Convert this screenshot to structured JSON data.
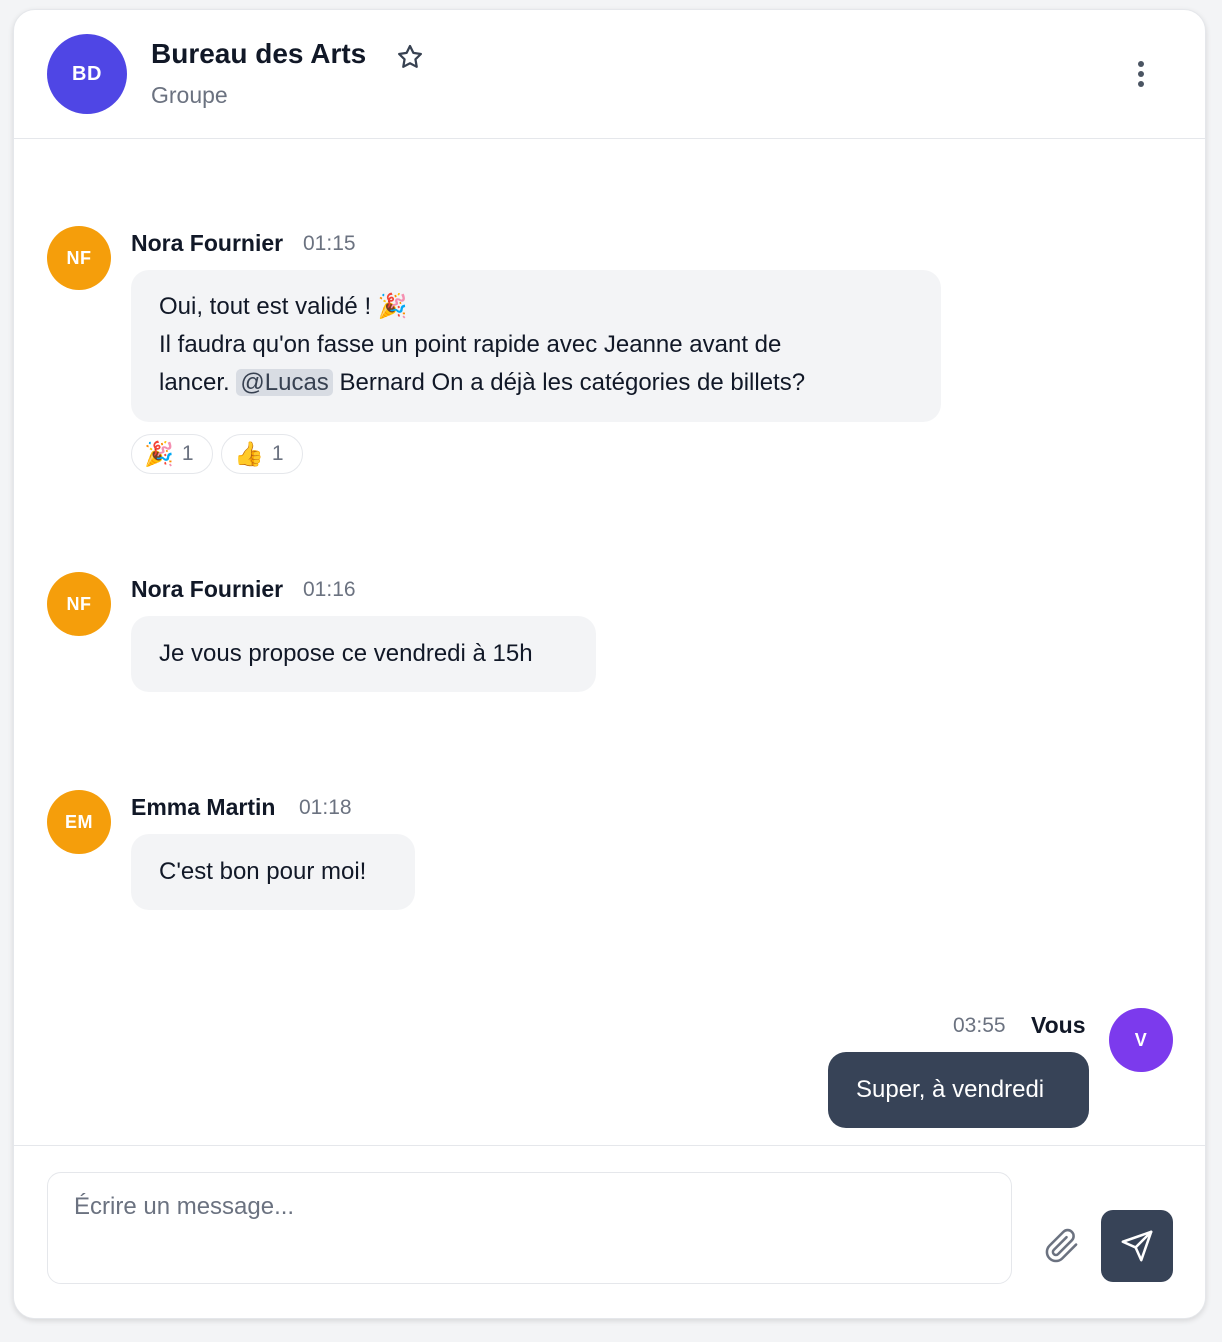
{
  "colors": {
    "group_avatar": "#4f46e5",
    "member_avatar": "#f59e0b",
    "own_avatar": "#7c3aed",
    "own_bubble": "#374357",
    "send_button": "#374357"
  },
  "header": {
    "avatar_initials": "BD",
    "title": "Bureau des Arts",
    "subtitle": "Groupe",
    "favorite_icon": "star-outline-icon",
    "menu_icon": "more-vertical-icon"
  },
  "messages": [
    {
      "avatar_initials": "NF",
      "sender": "Nora Fournier",
      "time": "01:15",
      "line1": "Oui, tout est validé ! 🎉",
      "line2": "Il faudra qu'on fasse un point rapide avec Jeanne avant de",
      "line3_before": "lancer. ",
      "mention": "@Lucas",
      "line3_after": " Bernard On a déjà les catégories de billets?",
      "reactions": [
        {
          "emoji": "🎉",
          "count": "1"
        },
        {
          "emoji": "👍",
          "count": "1"
        }
      ]
    },
    {
      "avatar_initials": "NF",
      "sender": "Nora Fournier",
      "time": "01:16",
      "text": "Je vous propose ce vendredi à 15h"
    },
    {
      "avatar_initials": "EM",
      "sender": "Emma Martin",
      "time": "01:18",
      "text": "C'est bon pour moi!"
    },
    {
      "avatar_initials": "V",
      "sender": "Vous",
      "time": "03:55",
      "text": "Super, à vendredi"
    }
  ],
  "composer": {
    "placeholder": "Écrire un message...",
    "attach_icon": "paperclip-icon",
    "send_icon": "send-icon"
  }
}
